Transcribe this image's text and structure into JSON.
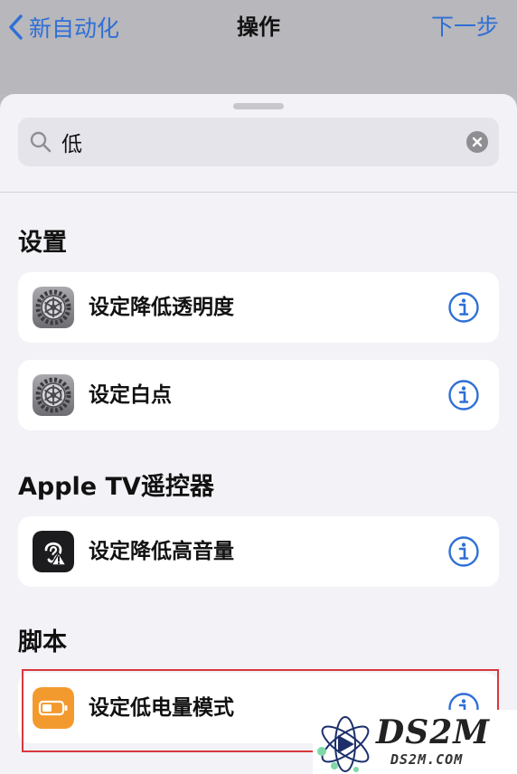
{
  "nav": {
    "back_label": "新自动化",
    "title": "操作",
    "next_label": "下一步"
  },
  "search": {
    "value": "低"
  },
  "sections": [
    {
      "title": "设置",
      "items": [
        {
          "label": "设定降低透明度",
          "icon": "settings-gear-icon"
        },
        {
          "label": "设定白点",
          "icon": "settings-gear-icon"
        }
      ]
    },
    {
      "title": "Apple TV遥控器",
      "items": [
        {
          "label": "设定降低高音量",
          "icon": "ear-warning-icon"
        }
      ]
    },
    {
      "title": "脚本",
      "items": [
        {
          "label": "设定低电量模式",
          "icon": "battery-icon"
        }
      ]
    }
  ],
  "watermark": {
    "text": "DS2M",
    "url": "DS2M.COM"
  },
  "colors": {
    "accent": "#2f6fd6",
    "highlight": "#d9373d",
    "battery_orange": "#f39a2e"
  }
}
